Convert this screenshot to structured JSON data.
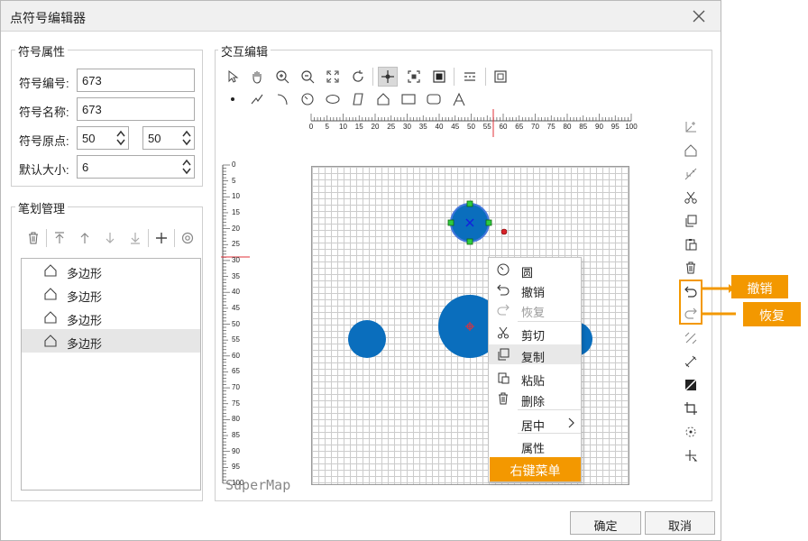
{
  "dialog": {
    "title": "点符号编辑器",
    "ok": "确定",
    "cancel": "取消"
  },
  "props": {
    "legend": "符号属性",
    "id_label": "符号编号:",
    "id_value": "673",
    "name_label": "符号名称:",
    "name_value": "673",
    "origin_label": "符号原点:",
    "origin_x": "50",
    "origin_y": "50",
    "size_label": "默认大小:",
    "size_value": "6"
  },
  "strokes": {
    "legend": "笔划管理",
    "items": [
      "多边形",
      "多边形",
      "多边形",
      "多边形"
    ],
    "selected_index": 3
  },
  "editor": {
    "legend": "交互编辑",
    "watermark": "SuperMap",
    "ruler_labels": [
      "0",
      "5",
      "10",
      "15",
      "20",
      "25",
      "30",
      "35",
      "40",
      "45",
      "50",
      "55",
      "60",
      "65",
      "70",
      "75",
      "80",
      "85",
      "90",
      "95",
      "100"
    ]
  },
  "context_menu": {
    "items": [
      {
        "label": "圆",
        "icon": "circle-icon"
      },
      {
        "label": "撤销",
        "icon": "undo-icon"
      },
      {
        "label": "恢复",
        "icon": "redo-icon",
        "disabled": true
      },
      {
        "label": "剪切",
        "icon": "scissors-icon"
      },
      {
        "label": "复制",
        "icon": "copy-icon"
      },
      {
        "label": "粘贴",
        "icon": "paste-icon"
      },
      {
        "label": "删除",
        "icon": "delete-icon"
      },
      {
        "label": "居中",
        "icon": "",
        "submenu": true
      },
      {
        "label": "属性",
        "icon": ""
      }
    ],
    "caption": "右键菜单"
  },
  "callouts": {
    "undo": "撤销",
    "redo": "恢复"
  },
  "colors": {
    "accent": "#f39800",
    "shape_fill": "#0a6ebd",
    "handle": "#2ecc40"
  }
}
